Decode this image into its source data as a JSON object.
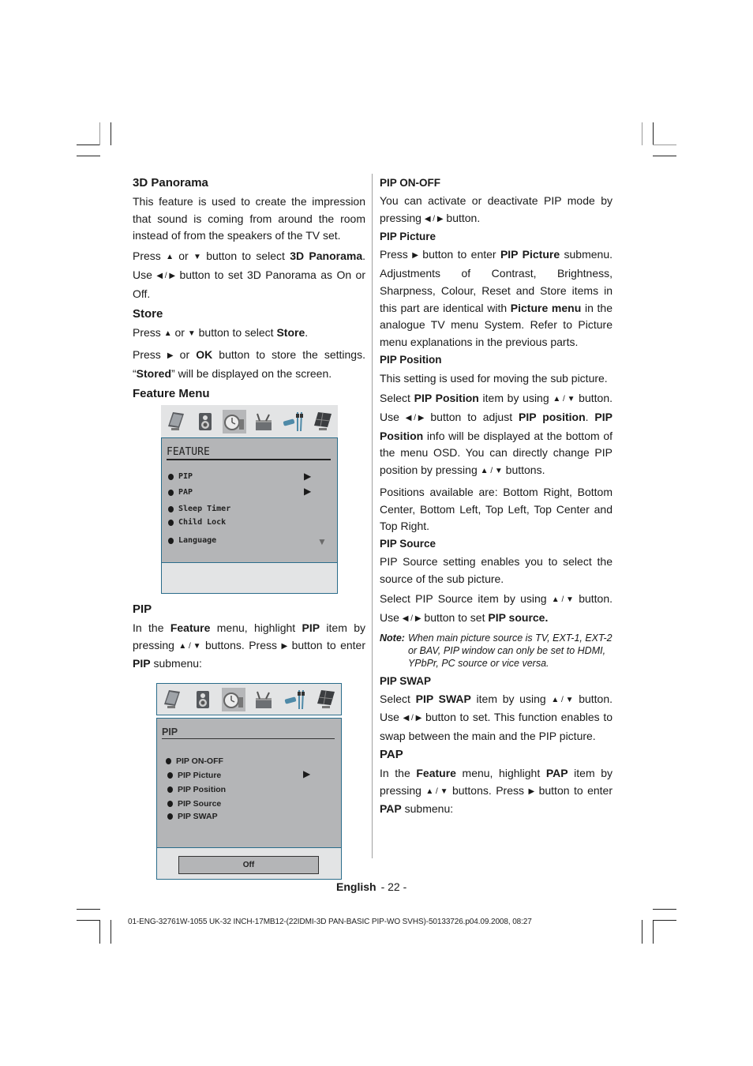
{
  "left": {
    "panorama": {
      "heading": "3D Panorama",
      "para1": "This feature is used to create the impression that sound is coming from around the room instead of from the speakers of the TV set.",
      "para2_a": "Press ",
      "up_arrow": "▲",
      "para2_b": " or ",
      "down_arrow": "▼",
      "para2_c": " button to select ",
      "para2_bold": "3D Panorama",
      "para2_d": ". Use ",
      "left_right": "◀ / ▶",
      "para2_e": " button  to set 3D Panorama as On or Off."
    },
    "store": {
      "heading": "Store",
      "para1_a": "Press ",
      "para1_b": " or ",
      "para1_c": " button to select ",
      "para1_bold": "Store",
      "para1_d": ".",
      "para2_a": "Press ",
      "right_arrow": "▶",
      "para2_b": " or ",
      "para2_ok": "OK",
      "para2_c": " button to store the settings. “",
      "para2_stored": "Stored",
      "para2_d": "” will be displayed on the screen."
    },
    "feature_menu": {
      "heading": "Feature Menu"
    },
    "pip": {
      "heading": "PIP",
      "t1": "In the ",
      "b1": "Feature",
      "t2": " menu, highlight ",
      "b2": "PIP",
      "t3": " item by pressing ",
      "updown": "▲ / ▼",
      "t4": "  buttons. Press ",
      "right": "▶",
      "t5": " button to enter ",
      "b3": "PIP",
      "t6": " submenu:"
    }
  },
  "osd_feature": {
    "icons": [
      "tv-picture-icon",
      "speaker-icon",
      "clock-feature-icon",
      "toolbox-install-icon",
      "cable-source-icon",
      "monitor-pc-icon"
    ],
    "selected_icon": 2,
    "title": "FEATURE",
    "items": [
      {
        "label": "PIP",
        "has_submenu": true
      },
      {
        "label": "PAP",
        "has_submenu": true
      },
      {
        "label": "Sleep Timer",
        "has_submenu": false
      },
      {
        "label": "Child Lock",
        "has_submenu": false
      },
      {
        "label": "Language",
        "has_submenu": false
      }
    ],
    "submenu_arrow": "▶",
    "scroll_arrow": "▼"
  },
  "osd_pip": {
    "icons": [
      "tv-picture-icon",
      "speaker-icon",
      "clock-feature-icon",
      "toolbox-install-icon",
      "cable-source-icon",
      "monitor-pc-icon"
    ],
    "selected_icon": 2,
    "title": "PIP",
    "items": [
      {
        "label": "PIP ON-OFF"
      },
      {
        "label": "PIP Picture"
      },
      {
        "label": "PIP Position"
      },
      {
        "label": "PIP Source"
      },
      {
        "label": "PIP SWAP"
      }
    ],
    "submenu_arrow": "▶",
    "value": "Off"
  },
  "right": {
    "onoff": {
      "heading": "PIP ON-OFF",
      "t1": "You can activate or deactivate PIP mode by pressing ",
      "lr": "◀ / ▶",
      "t2": " button."
    },
    "picture": {
      "heading": "PIP Picture",
      "t1": "Press ",
      "r": "▶",
      "t2": " button to enter ",
      "b1": "PIP Picture",
      "t3": " submenu. Adjustments of Contrast, Brightness, Sharpness, Colour,  Reset and Store items in this part are identical with ",
      "b2": "Picture menu",
      "t4": " in the analogue TV menu System.  Refer to Picture menu explanations in the previous parts."
    },
    "position": {
      "heading": "PIP Position",
      "p1": "This setting is used for moving the sub picture.",
      "t1": "Select  ",
      "b1": "PIP Position",
      "t2": "  item by using ",
      "ud": "▲ / ▼",
      "t3": " button. Use ",
      "lr": "◀ / ▶",
      "t4": " button to adjust ",
      "b2": "PIP position",
      "t5": ". ",
      "b3": "PIP Position",
      "t6": " info will be displayed at the bottom of the menu OSD. You can directly change PIP position by pressing ",
      "t7": " buttons.",
      "p3": "Positions available are: Bottom Right, Bottom Center, Bottom Left, Top Left, Top Center and Top Right."
    },
    "source": {
      "heading": "PIP Source",
      "p1": "PIP Source setting enables you to select the source of the sub picture.",
      "t1": "Select PIP Source  item by using ",
      "ud": "▲ / ▼",
      "t2": " button. Use ",
      "lr": "◀ / ▶",
      "t3": " button to set ",
      "b1": "PIP source.",
      "note_label": "Note:",
      "note_text": "When main picture source is TV, EXT-1, EXT-2 or BAV, PIP window can only be set to HDMI, YPbPr, PC source or vice versa."
    },
    "swap": {
      "heading": "PIP SWAP",
      "t1": "Select ",
      "b1": "PIP SWAP",
      "t2": "  item by using ",
      "ud": "▲ / ▼",
      "t3": " button. Use ",
      "lr": "◀ / ▶",
      "t4": " button to set. This function enables to swap between the main and the PIP picture."
    },
    "pap": {
      "heading": "PAP",
      "t1": "In the ",
      "b1": "Feature",
      "t2": " menu, highlight ",
      "b2": "PAP",
      "t3": " item by pressing ",
      "ud": "▲ / ▼",
      "t4": " buttons. Press ",
      "r": "▶",
      "t5": " button to enter ",
      "b3": "PAP",
      "t6": " submenu:"
    }
  },
  "footer": {
    "language": "English",
    "page": "- 22 -",
    "doc_id": "01-ENG-32761W-1055 UK-32 INCH-17MB12-(22IDMI-3D PAN-BASIC PIP-WO SVHS)-50133726.p04.09.2008, 08:27"
  }
}
